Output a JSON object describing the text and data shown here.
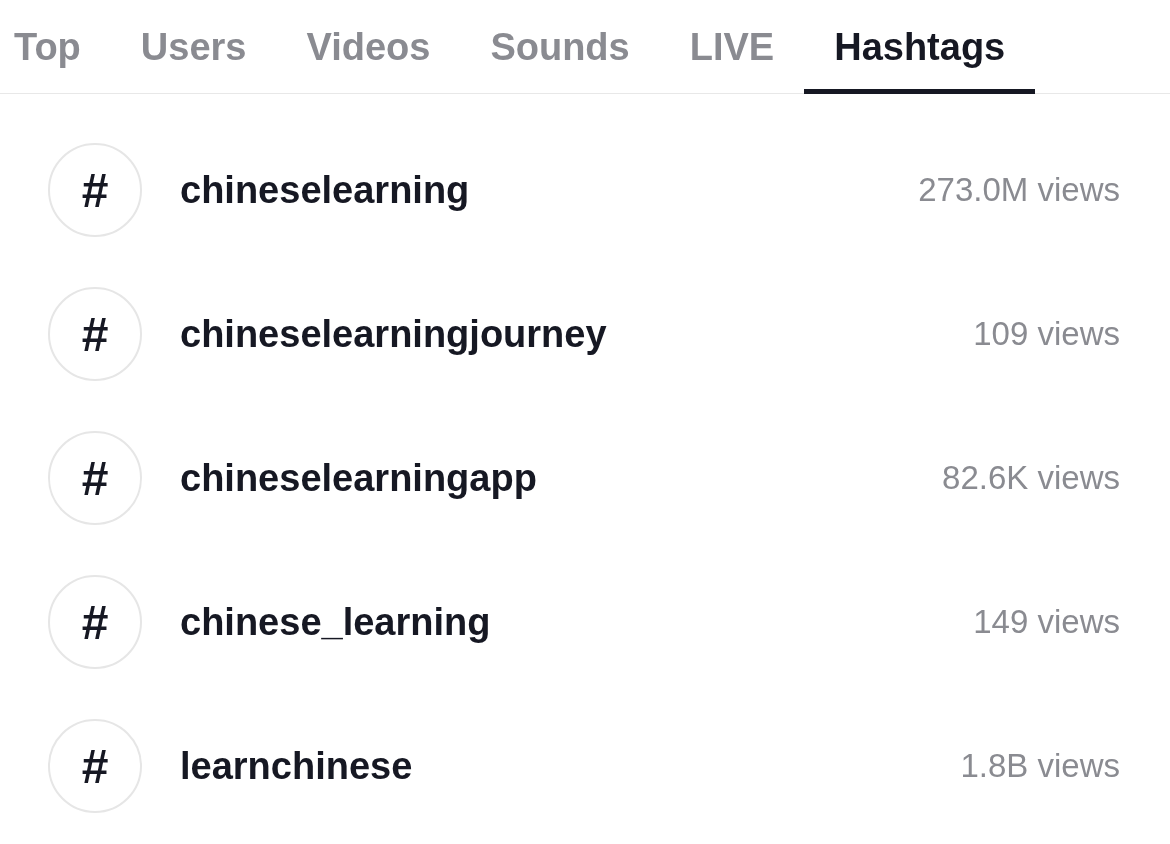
{
  "tabs": [
    {
      "label": "Top",
      "selected": false
    },
    {
      "label": "Users",
      "selected": false
    },
    {
      "label": "Videos",
      "selected": false
    },
    {
      "label": "Sounds",
      "selected": false
    },
    {
      "label": "LIVE",
      "selected": false
    },
    {
      "label": "Hashtags",
      "selected": true
    }
  ],
  "hashtags": [
    {
      "symbol": "#",
      "name": "chineselearning",
      "views": "273.0M views"
    },
    {
      "symbol": "#",
      "name": "chineselearningjourney",
      "views": "109 views"
    },
    {
      "symbol": "#",
      "name": "chineselearningapp",
      "views": "82.6K views"
    },
    {
      "symbol": "#",
      "name": "chinese_learning",
      "views": "149 views"
    },
    {
      "symbol": "#",
      "name": "learnchinese",
      "views": "1.8B views"
    }
  ]
}
